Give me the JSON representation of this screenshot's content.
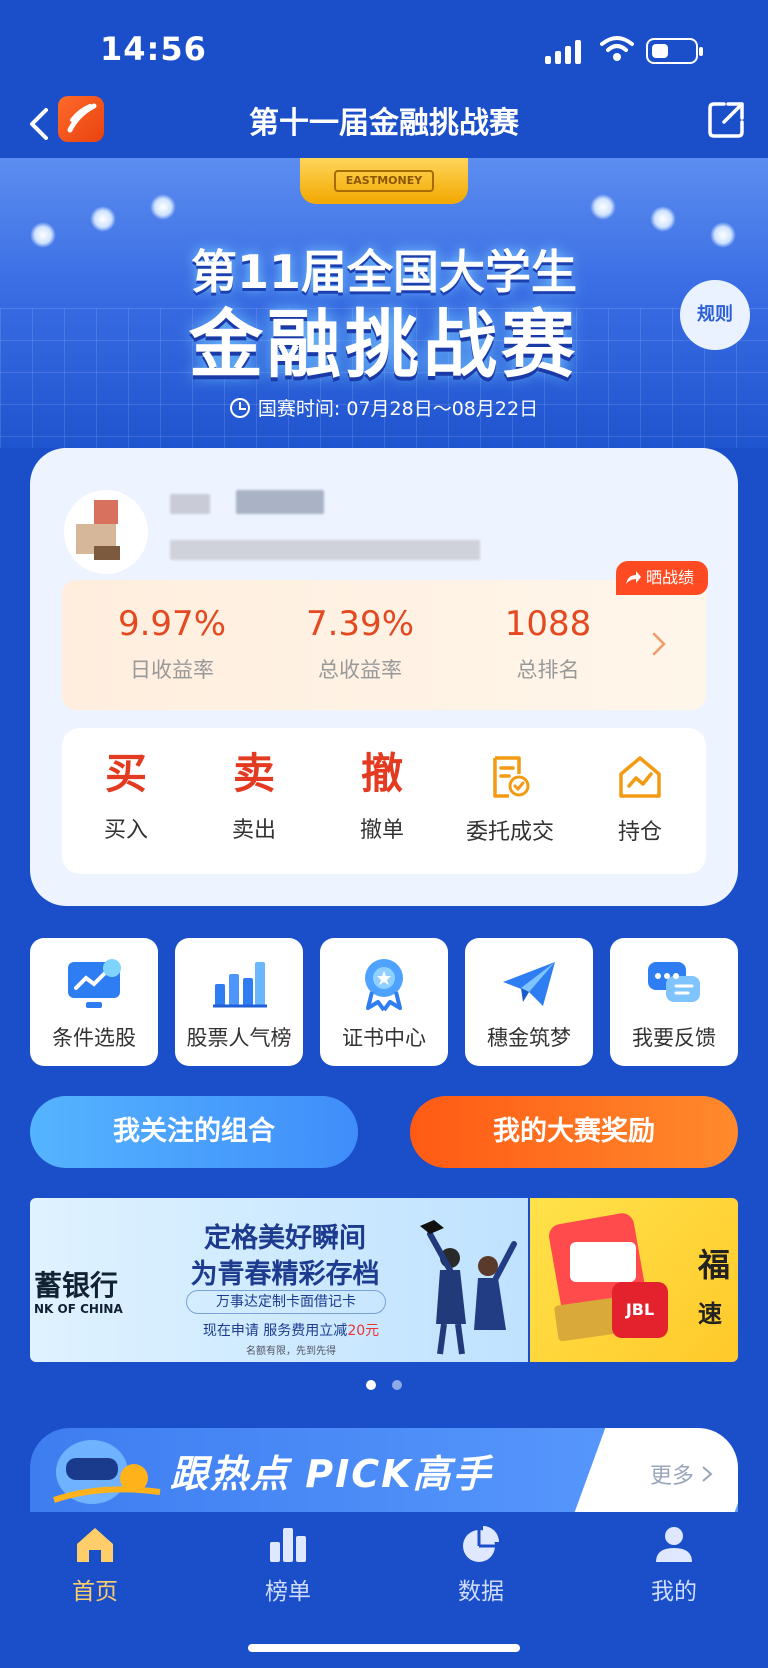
{
  "status_bar": {
    "time": "14:56"
  },
  "nav": {
    "title": "第十一届金融挑战赛",
    "back_icon": "back-chevron-icon",
    "share_icon": "share-icon"
  },
  "hero": {
    "trophy_text": "EASTMONEY",
    "line1": "第11届全国大学生",
    "line2": "金融挑战赛",
    "rules_label": "规则",
    "period_label": "国赛时间:",
    "period_value": "07月28日～08月22日"
  },
  "profile": {
    "share_badge": "晒战绩",
    "stats": [
      {
        "value": "9.97%",
        "label": "日收益率"
      },
      {
        "value": "7.39%",
        "label": "总收益率"
      },
      {
        "value": "1088",
        "label": "总排名"
      }
    ]
  },
  "trade_actions": [
    {
      "glyph": "买",
      "label": "买入"
    },
    {
      "glyph": "卖",
      "label": "卖出"
    },
    {
      "glyph": "撤",
      "label": "撤单"
    },
    {
      "icon": "order-document-icon",
      "label": "委托成交"
    },
    {
      "icon": "holdings-house-icon",
      "label": "持仓"
    }
  ],
  "tools": [
    {
      "icon": "stock-screener-icon",
      "label": "条件选股"
    },
    {
      "icon": "popularity-chart-icon",
      "label": "股票人气榜"
    },
    {
      "icon": "certificate-icon",
      "label": "证书中心"
    },
    {
      "icon": "paper-plane-icon",
      "label": "穗金筑梦"
    },
    {
      "icon": "feedback-chat-icon",
      "label": "我要反馈"
    }
  ],
  "buttons": {
    "portfolio": "我关注的组合",
    "rewards": "我的大赛奖励"
  },
  "banner": {
    "bank_name": "蓄银行",
    "bank_en": "NK OF CHINA",
    "headline1": "定格美好瞬间",
    "headline2": "为青春精彩存档",
    "card_note": "万事达定制卡面借记卡",
    "promo": "现在申请 服务费用立减",
    "promo_amount": "20元",
    "fine_print": "名额有限，先到先得",
    "next_text1": "福",
    "next_text2": "速",
    "next_brand": "JBL"
  },
  "hot_pick": {
    "title": "跟热点 PICK高手",
    "more": "更多"
  },
  "tabs": [
    {
      "icon": "home-icon",
      "label": "首页",
      "active": true
    },
    {
      "icon": "ranking-icon",
      "label": "榜单",
      "active": false
    },
    {
      "icon": "pie-data-icon",
      "label": "数据",
      "active": false
    },
    {
      "icon": "profile-icon",
      "label": "我的",
      "active": false
    }
  ],
  "colors": {
    "brand_blue": "#1b4fc9",
    "accent_red": "#e44a21",
    "accent_orange": "#ff6a1a",
    "tab_active": "#ffce6b"
  }
}
